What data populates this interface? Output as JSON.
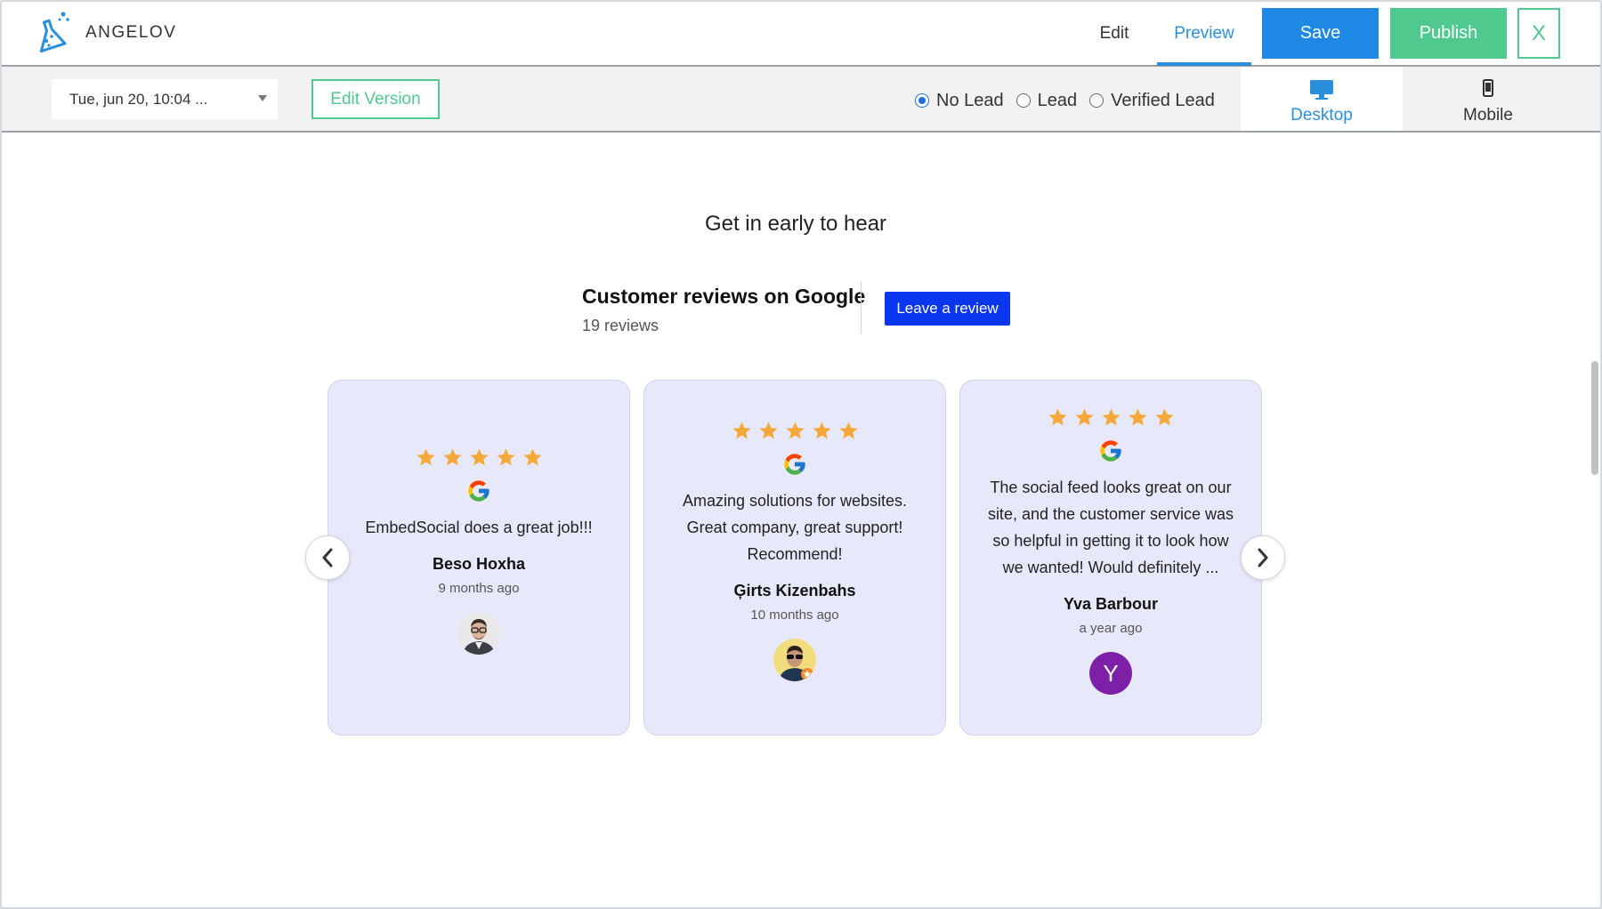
{
  "app": {
    "brand": "ANGELOV"
  },
  "topnav": {
    "edit": "Edit",
    "preview": "Preview",
    "save": "Save",
    "publish": "Publish",
    "close": "X"
  },
  "toolbar": {
    "version_value": "Tue, jun 20, 10:04 ...",
    "edit_version": "Edit Version",
    "lead_options": [
      "No Lead",
      "Lead",
      "Verified Lead"
    ],
    "lead_selected": "No Lead",
    "device_tabs": {
      "desktop": "Desktop",
      "mobile": "Mobile"
    },
    "active_device": "desktop"
  },
  "content": {
    "heading": "Get in early to hear",
    "widget": {
      "title": "Customer reviews on Google",
      "count": "19 reviews",
      "leave_review": "Leave a review",
      "reviews": [
        {
          "text": "EmbedSocial does a great job!!!",
          "name": "Beso Hoxha",
          "time": "9 months ago",
          "rating": 5,
          "avatar": "photo"
        },
        {
          "text": "Amazing solutions for websites. Great company, great support! Recommend!",
          "name": "Ģirts Kizenbahs",
          "time": "10 months ago",
          "rating": 5,
          "avatar": "photo"
        },
        {
          "text": "The social feed looks great on our site, and the customer service was so helpful in getting it to look how we wanted! Would definitely ...",
          "name": "Yva Barbour",
          "time": "a year ago",
          "rating": 5,
          "avatar": "Y"
        }
      ]
    }
  },
  "colors": {
    "accent_blue": "#2b8fdc",
    "save": "#1e88e5",
    "publish": "#4fc98e",
    "leave_review": "#0a36f0",
    "card_bg": "#e7e9fb",
    "star": "#f4a83a"
  },
  "icons": {
    "logo": "flask-icon",
    "desktop": "monitor-icon",
    "mobile": "phone-icon",
    "prev": "chevron-left-icon",
    "next": "chevron-right-icon",
    "source": "google-icon",
    "rating": "star-icon"
  }
}
